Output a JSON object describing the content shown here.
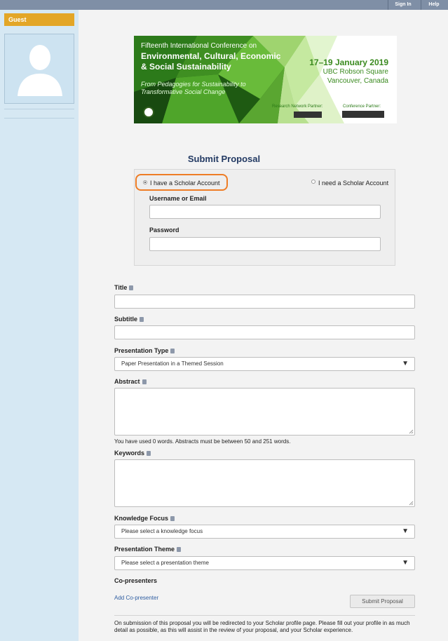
{
  "topbar": {
    "sign_in": "Sign In",
    "help": "Help"
  },
  "sidebar": {
    "guest_label": "Guest"
  },
  "banner": {
    "line1": "Fifteenth International Conference on",
    "line2": "Environmental, Cultural, Economic & Social Sustainability",
    "line3": "From Pedagogies for Sustainability to Transformative Social Change",
    "date": "17–19 January 2019",
    "venue_line1": "UBC Robson Square",
    "venue_line2": "Vancouver, Canada",
    "research_partner": "Research Network Partner:",
    "conference_partner": "Conference Partner:"
  },
  "form": {
    "title": "Submit Proposal",
    "account_option_have": "I have a Scholar Account",
    "account_option_need": "I need a Scholar Account",
    "username_label": "Username or Email",
    "username_value": "",
    "password_label": "Password",
    "password_value": "",
    "title_label": "Title",
    "title_value": "",
    "subtitle_label": "Subtitle",
    "subtitle_value": "",
    "presentation_type_label": "Presentation Type",
    "presentation_type_value": "Paper Presentation in a Themed Session",
    "abstract_label": "Abstract",
    "abstract_value": "",
    "abstract_help": "You have used 0 words. Abstracts must be between 50 and 251 words.",
    "keywords_label": "Keywords",
    "keywords_value": "",
    "knowledge_focus_label": "Knowledge Focus",
    "knowledge_focus_value": "Please select a knowledge focus",
    "presentation_theme_label": "Presentation Theme",
    "presentation_theme_value": "Please select a presentation theme",
    "copresenters_label": "Co-presenters",
    "add_copresenter_link": "Add Co-presenter",
    "submit_button": "Submit Proposal",
    "footer_note": "On submission of this proposal you will be redirected to your Scholar profile page. Please fill out your profile in as much detail as possible, as this will assist in the review of your proposal, and your Scholar experience."
  },
  "colors": {
    "topbar": "#7f8fa6",
    "sidebar": "#d6e8f3",
    "guest_tab": "#e3a627",
    "title": "#233a63",
    "highlight": "#ee7d26",
    "link": "#2f5ea1"
  }
}
